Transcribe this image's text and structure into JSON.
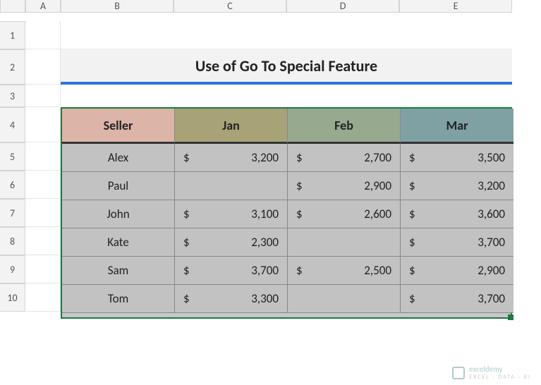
{
  "columns": [
    "",
    "A",
    "B",
    "C",
    "D",
    "E"
  ],
  "rows": [
    "1",
    "2",
    "3",
    "4",
    "5",
    "6",
    "7",
    "8",
    "9",
    "10"
  ],
  "title": "Use of Go To Special Feature",
  "headers": {
    "seller": "Seller",
    "jan": "Jan",
    "feb": "Feb",
    "mar": "Mar"
  },
  "currency": "$",
  "data": [
    {
      "seller": "Alex",
      "jan": "3,200",
      "feb": "2,700",
      "mar": "3,500"
    },
    {
      "seller": "Paul",
      "jan": "",
      "feb": "2,900",
      "mar": "3,200"
    },
    {
      "seller": "John",
      "jan": "3,100",
      "feb": "2,600",
      "mar": "3,600"
    },
    {
      "seller": "Kate",
      "jan": "2,300",
      "feb": "",
      "mar": "3,700"
    },
    {
      "seller": "Sam",
      "jan": "3,700",
      "feb": "2,500",
      "mar": "2,900"
    },
    {
      "seller": "Tom",
      "jan": "3,300",
      "feb": "",
      "mar": "3,700"
    }
  ],
  "watermark": {
    "brand": "exceldemy",
    "tag": "EXCEL · DATA · BI"
  }
}
